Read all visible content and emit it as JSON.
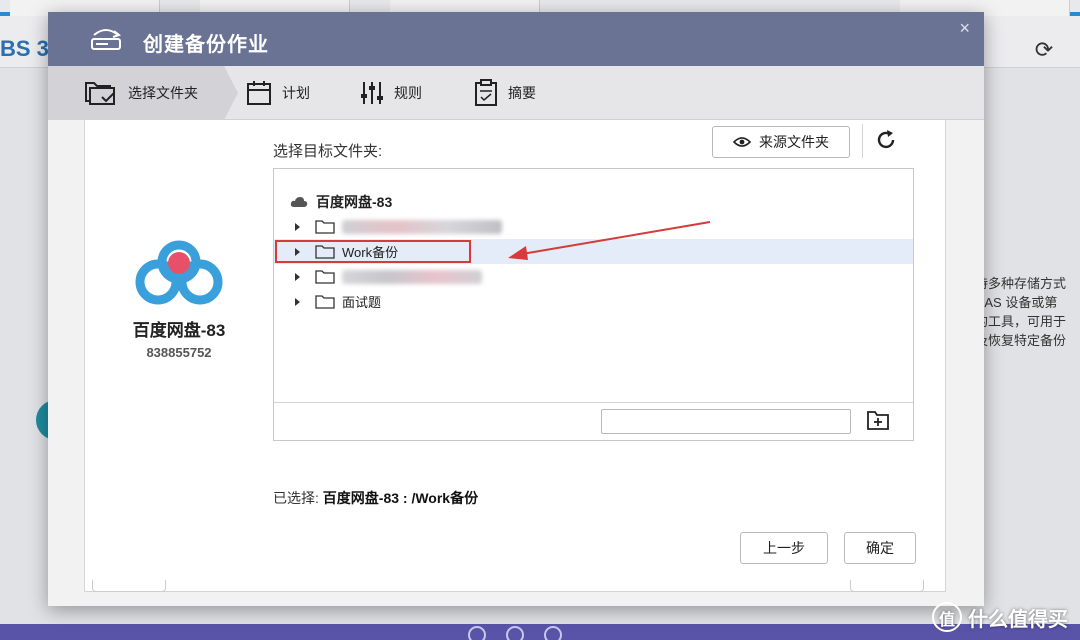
{
  "background": {
    "app_title": "BS 3",
    "side_text_lines": [
      "持多种存储方式",
      "NAS 设备或第",
      "的工具，可用于",
      "及恢复特定备份"
    ],
    "watermark": "什么值得买"
  },
  "modal": {
    "title": "创建备份作业",
    "close_glyph": "×",
    "steps": [
      {
        "label": "选择文件夹",
        "icon": "folder-check-icon",
        "active": true
      },
      {
        "label": "计划",
        "icon": "calendar-icon",
        "active": false
      },
      {
        "label": "规则",
        "icon": "sliders-icon",
        "active": false
      },
      {
        "label": "摘要",
        "icon": "clipboard-icon",
        "active": false
      }
    ],
    "account": {
      "name": "百度网盘-83",
      "id": "838855752",
      "logo": "baidu-netdisk-logo"
    },
    "target_label": "选择目标文件夹:",
    "source_button": "来源文件夹",
    "tree": {
      "root": "百度网盘-83",
      "items": [
        {
          "label": "",
          "blurred": true,
          "selected": false
        },
        {
          "label": "Work备份",
          "blurred": false,
          "selected": true
        },
        {
          "label": "",
          "blurred": true,
          "selected": false
        },
        {
          "label": "面试题",
          "blurred": false,
          "selected": false
        }
      ],
      "new_folder_value": ""
    },
    "selected_prefix": "已选择:",
    "selected_path": "百度网盘-83 : /Work备份",
    "buttons": {
      "prev": "上一步",
      "ok": "确定"
    },
    "colors": {
      "header": "#6b7394",
      "highlight": "#d63a3a",
      "selected_row": "#e3ecf8",
      "brand_blue": "#3aa0dc",
      "brand_red": "#e8506a"
    }
  }
}
